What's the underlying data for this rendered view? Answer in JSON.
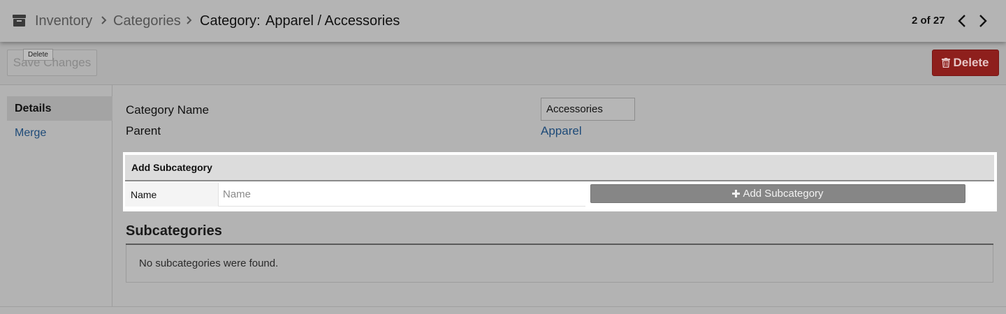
{
  "header": {
    "breadcrumb": [
      "Inventory",
      "Categories"
    ],
    "current_label": "Category:",
    "current_value": "Apparel / Accessories",
    "pager": "2 of 27",
    "icons": {
      "app": "archive-box-icon",
      "separator": "chevron-right-icon",
      "prev": "chevron-left-icon",
      "next": "chevron-right-icon"
    }
  },
  "toolbar": {
    "save_label": "Save Changes",
    "tooltip": "Delete",
    "delete_label": "Delete",
    "delete_icon": "trash-icon"
  },
  "sidebar": {
    "items": [
      {
        "label": "Details",
        "active": true
      },
      {
        "label": "Merge",
        "active": false
      }
    ]
  },
  "form": {
    "category_name_label": "Category Name",
    "category_name_value": "Accessories",
    "parent_label": "Parent",
    "parent_value": "Apparel"
  },
  "add_subcategory": {
    "heading": "Add Subcategory",
    "name_label": "Name",
    "name_placeholder": "Name",
    "button_label": "Add Subcategory",
    "button_icon": "plus-icon"
  },
  "subcategories": {
    "heading": "Subcategories",
    "empty_message": "No subcategories were found."
  },
  "colors": {
    "delete_button": "#8e1f1c",
    "link": "#1d4a78",
    "add_button": "#868686"
  }
}
